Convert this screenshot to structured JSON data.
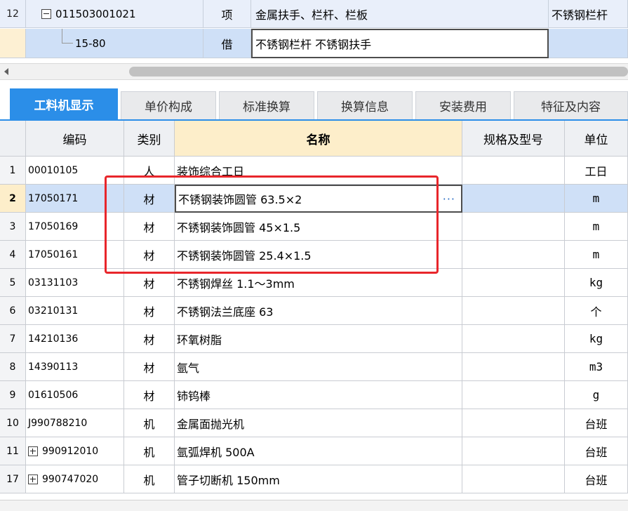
{
  "top_rows": [
    {
      "num": "12",
      "code": "011503001021",
      "type": "项",
      "name": "金属扶手、栏杆、栏板",
      "extra": "不锈钢栏杆"
    },
    {
      "num": "",
      "code": "15-80",
      "type": "借",
      "name": "不锈钢栏杆 不锈钢扶手",
      "extra": ""
    }
  ],
  "tabs": [
    "工料机显示",
    "单价构成",
    "标准换算",
    "换算信息",
    "安装费用",
    "特征及内容"
  ],
  "columns": {
    "code": "编码",
    "type": "类别",
    "name": "名称",
    "spec": "规格及型号",
    "unit": "单位"
  },
  "rows": [
    {
      "num": "1",
      "code": "00010105",
      "type": "人",
      "name": "装饰综合工日",
      "unit": "工日"
    },
    {
      "num": "2",
      "code": "17050171",
      "type": "材",
      "name": "不锈钢装饰圆管 63.5×2",
      "unit": "m"
    },
    {
      "num": "3",
      "code": "17050169",
      "type": "材",
      "name": "不锈钢装饰圆管 45×1.5",
      "unit": "m"
    },
    {
      "num": "4",
      "code": "17050161",
      "type": "材",
      "name": "不锈钢装饰圆管 25.4×1.5",
      "unit": "m"
    },
    {
      "num": "5",
      "code": "03131103",
      "type": "材",
      "name": "不锈钢焊丝 1.1～3mm",
      "unit": "kg"
    },
    {
      "num": "6",
      "code": "03210131",
      "type": "材",
      "name": "不锈钢法兰底座 63",
      "unit": "个"
    },
    {
      "num": "7",
      "code": "14210136",
      "type": "材",
      "name": "环氧树脂",
      "unit": "kg"
    },
    {
      "num": "8",
      "code": "14390113",
      "type": "材",
      "name": "氩气",
      "unit": "m3"
    },
    {
      "num": "9",
      "code": "01610506",
      "type": "材",
      "name": "铈钨棒",
      "unit": "g"
    },
    {
      "num": "10",
      "code": "J990788210",
      "type": "机",
      "name": "金属面抛光机",
      "unit": "台班"
    },
    {
      "num": "11",
      "code": "990912010",
      "type": "机",
      "name": "氩弧焊机 500A",
      "unit": "台班"
    },
    {
      "num": "17",
      "code": "990747020",
      "type": "机",
      "name": "管子切断机 150mm",
      "unit": "台班"
    }
  ],
  "selected_dots": "···",
  "colors": {
    "accent": "#2b8ee8",
    "highlight": "#e8262b",
    "selected": "#cfe0f7",
    "header_name": "#fdeeca"
  }
}
